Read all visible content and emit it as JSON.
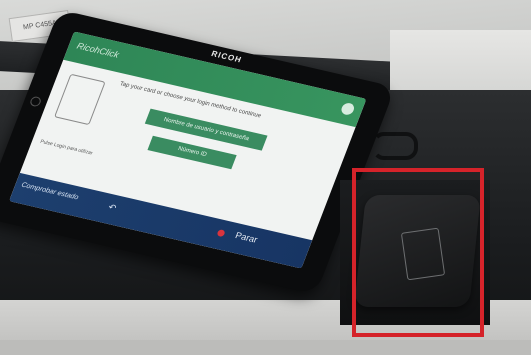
{
  "printer": {
    "brand": "RICOH",
    "model_label": "MP C455A"
  },
  "screen": {
    "logo": "RicohClick",
    "instruction": "Tap your card or choose your login method to continue",
    "buttons": {
      "login_user_password": "Nombre de usuario y contraseña",
      "login_id": "Número ID"
    },
    "side_text": "Pulse Login para utilizar",
    "footer": {
      "counter": "Comprobar estado",
      "stop_label": "Parar"
    }
  },
  "colors": {
    "screen_header": "#2e8656",
    "screen_footer": "#1d3f6e",
    "highlight": "#d5232a"
  },
  "icons": {
    "card_icon": "card-tap-icon",
    "reader_icon": "card-tap-icon",
    "back_icon": "back-arrow-icon",
    "settings_icon": "settings-icon"
  }
}
